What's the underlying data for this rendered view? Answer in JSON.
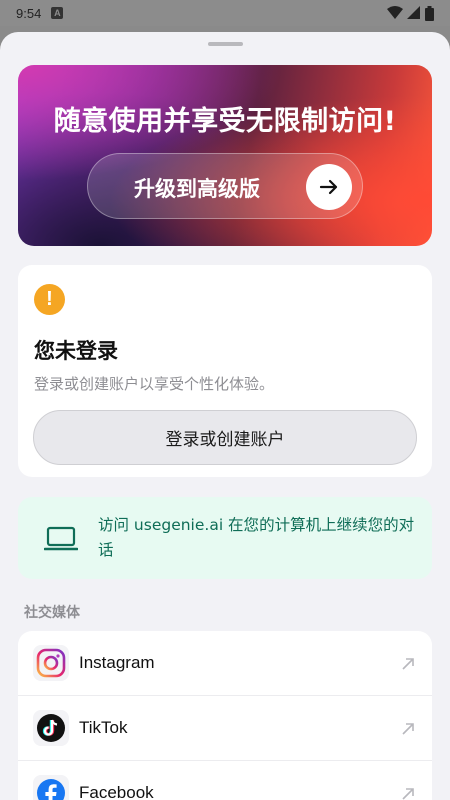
{
  "status_bar": {
    "time": "9:54",
    "notification_letter": "A"
  },
  "premium": {
    "title": "随意使用并享受无限制访问!",
    "button_label": "升级到高级版"
  },
  "login_card": {
    "title": "您未登录",
    "subtitle": "登录或创建账户以享受个性化体验。",
    "button_label": "登录或创建账户"
  },
  "visit_card": {
    "text": "访问 usegenie.ai 在您的计算机上继续您的对话"
  },
  "social_section": {
    "label": "社交媒体",
    "items": [
      {
        "name": "Instagram",
        "icon": "instagram-icon"
      },
      {
        "name": "TikTok",
        "icon": "tiktok-icon"
      },
      {
        "name": "Facebook",
        "icon": "facebook-icon"
      }
    ]
  },
  "colors": {
    "accent_green": "#0f6d57",
    "warning": "#f5a623",
    "background": "#f2f2f6"
  }
}
